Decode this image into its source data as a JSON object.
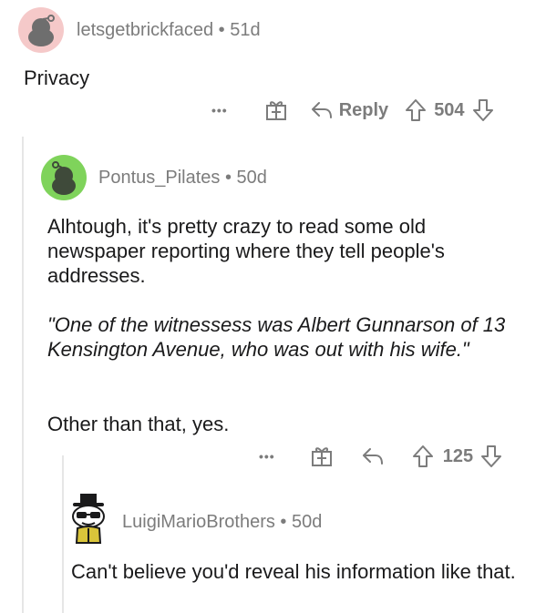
{
  "comment1": {
    "username": "letsgetbrickfaced",
    "age": "51d",
    "text": "Privacy",
    "actions": {
      "more": "•••",
      "reply_label": "Reply",
      "score": "504"
    }
  },
  "comment2": {
    "username": "Pontus_Pilates",
    "age": "50d",
    "paragraphs": [
      "Alhtough, it's pretty crazy to read some old newspaper reporting where they tell people's addresses.",
      "\"One of the witnessess was Albert Gunnarson of 13 Kensington Avenue, who was out with his wife.\"",
      "Other than that, yes."
    ],
    "actions": {
      "more": "•••",
      "score": "125"
    }
  },
  "comment3": {
    "username": "LuigiMarioBrothers",
    "age": "50d",
    "text": "Can't believe you'd reveal his information like that."
  },
  "colors": {
    "meta_gray": "#7c7c7c",
    "text": "#1a1a1b",
    "avatar1_bg": "#f5c9c9",
    "avatar2_bg": "#7fd35b",
    "thread_line": "#e6e6e6"
  }
}
